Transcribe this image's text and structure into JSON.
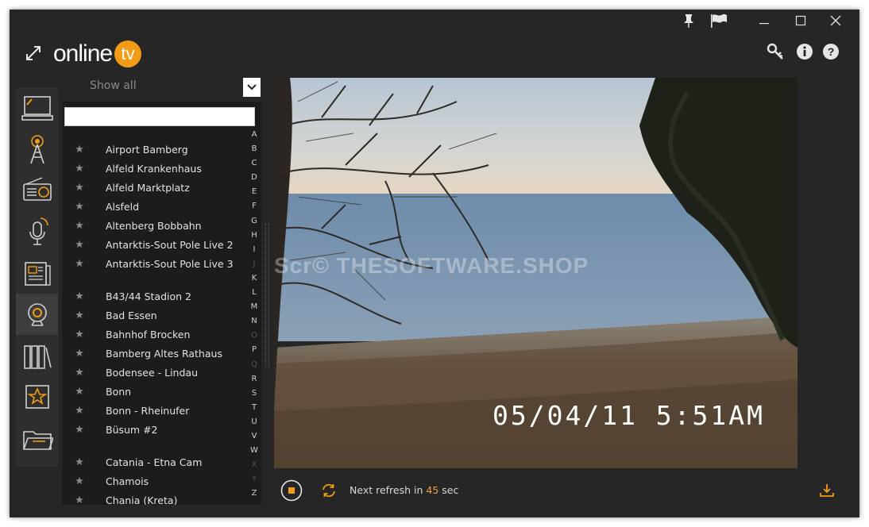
{
  "app": {
    "logo_main": "online",
    "logo_accent": "tv",
    "accent_color": "#f29b15"
  },
  "titlebar": {
    "icons": [
      "pin-icon",
      "flag-icon",
      "minimize-icon",
      "maximize-icon",
      "close-icon"
    ]
  },
  "header_icons": [
    "expand-icon",
    "key-icon",
    "info-icon",
    "help-icon"
  ],
  "sidebar": {
    "items": [
      {
        "name": "tv-icon",
        "active": false
      },
      {
        "name": "radio-tower-icon",
        "active": false
      },
      {
        "name": "radio-icon",
        "active": false
      },
      {
        "name": "podcast-icon",
        "active": false
      },
      {
        "name": "news-icon",
        "active": false
      },
      {
        "name": "webcam-icon",
        "active": true
      },
      {
        "name": "library-icon",
        "active": false
      },
      {
        "name": "favorites-icon",
        "active": false
      },
      {
        "name": "folder-icon",
        "active": false
      }
    ]
  },
  "filter": {
    "label": "Show all"
  },
  "search": {
    "value": "",
    "placeholder": ""
  },
  "list": {
    "groups": [
      [
        "Airport Bamberg",
        "Alfeld Krankenhaus",
        "Alfeld Marktplatz",
        "Alsfeld",
        "Altenberg Bobbahn",
        "Antarktis-Sout Pole Live 2",
        "Antarktis-Sout Pole Live 3"
      ],
      [
        "B43/44 Stadion 2",
        "Bad Essen",
        "Bahnhof Brocken",
        "Bamberg Altes Rathaus",
        "Bodensee - Lindau",
        "Bonn",
        "Bonn - Rheinufer",
        "Büsum #2"
      ],
      [
        "Catania - Etna Cam",
        "Chamois",
        "Chania (Kreta)"
      ]
    ]
  },
  "alphabet": [
    {
      "l": "A",
      "on": true
    },
    {
      "l": "B",
      "on": true
    },
    {
      "l": "C",
      "on": true
    },
    {
      "l": "D",
      "on": true
    },
    {
      "l": "E",
      "on": true
    },
    {
      "l": "F",
      "on": true
    },
    {
      "l": "G",
      "on": true
    },
    {
      "l": "H",
      "on": true
    },
    {
      "l": "I",
      "on": true
    },
    {
      "l": "J",
      "on": false
    },
    {
      "l": "K",
      "on": true
    },
    {
      "l": "L",
      "on": true
    },
    {
      "l": "M",
      "on": true
    },
    {
      "l": "N",
      "on": true
    },
    {
      "l": "O",
      "on": false
    },
    {
      "l": "P",
      "on": true
    },
    {
      "l": "Q",
      "on": false
    },
    {
      "l": "R",
      "on": true
    },
    {
      "l": "S",
      "on": true
    },
    {
      "l": "T",
      "on": true
    },
    {
      "l": "U",
      "on": true
    },
    {
      "l": "V",
      "on": true
    },
    {
      "l": "W",
      "on": true
    },
    {
      "l": "X",
      "on": false
    },
    {
      "l": "Y",
      "on": false
    },
    {
      "l": "Z",
      "on": true
    }
  ],
  "video": {
    "timestamp": "05/04/11 5:51AM",
    "watermark": "Scr© THESOFTWARE.SHOP"
  },
  "controls": {
    "refresh_prefix": "Next refresh in ",
    "refresh_value": "45",
    "refresh_suffix": " sec"
  }
}
